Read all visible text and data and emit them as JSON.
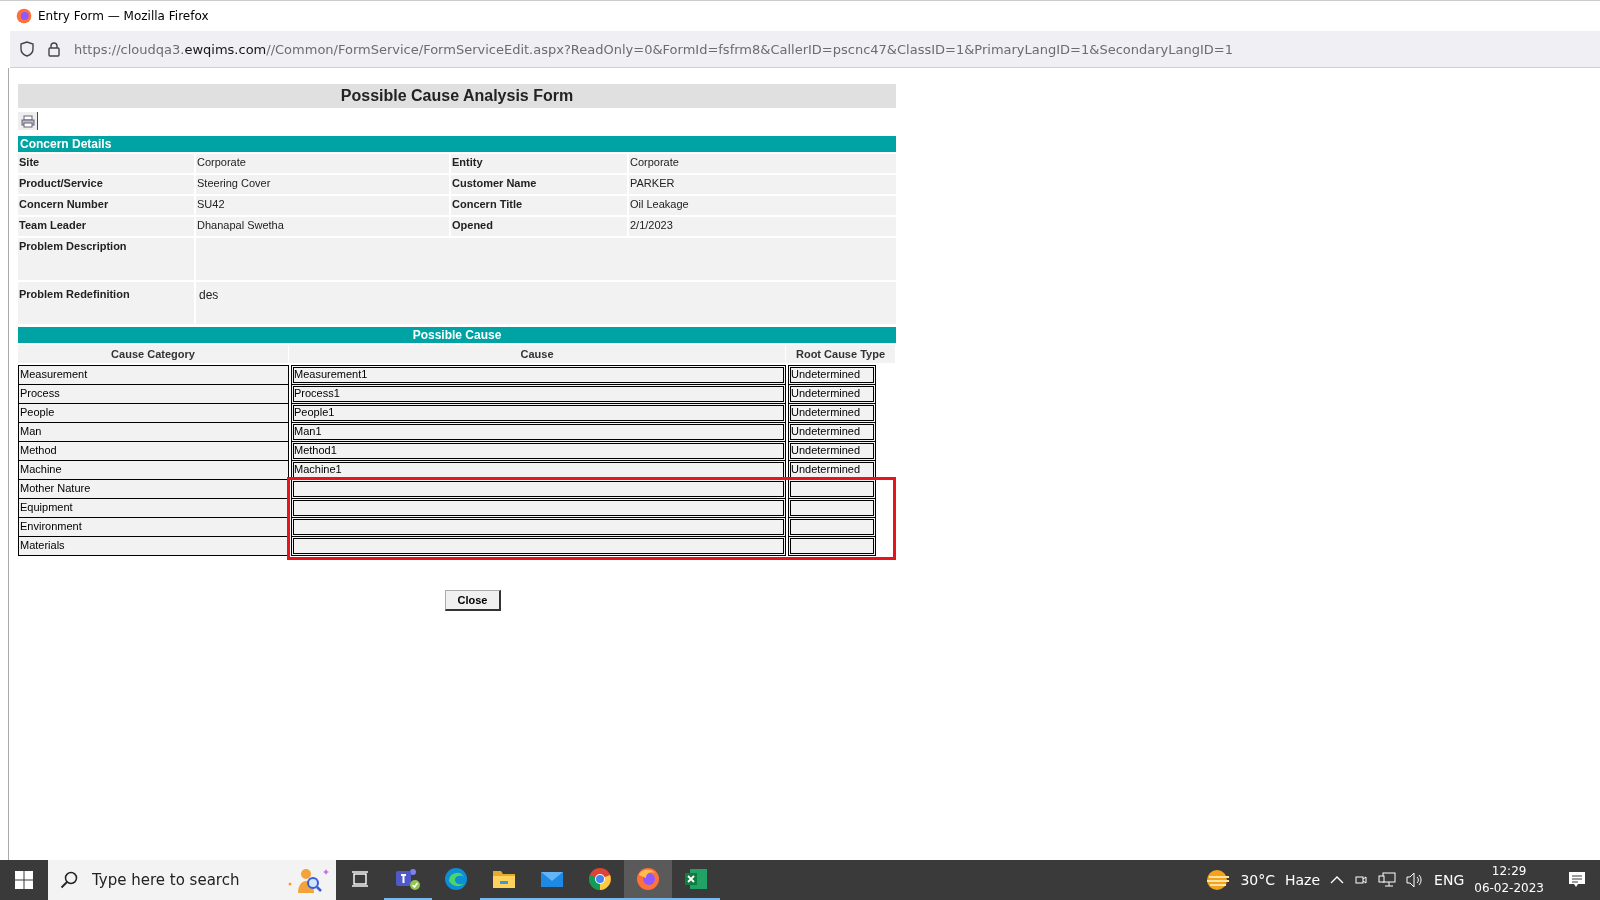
{
  "window": {
    "title": "Entry Form — Mozilla Firefox"
  },
  "address_bar": {
    "url_start": "https://cloudqa3.",
    "url_domain": "ewqims.com",
    "url_rest": "//Common/FormService/FormServiceEdit.aspx?ReadOnly=0&FormId=fsfrm8&CallerID=pscnc47&ClassID=1&PrimaryLangID=1&SecondaryLangID=1"
  },
  "form": {
    "title": "Possible Cause Analysis Form",
    "concern_details": {
      "heading": "Concern Details",
      "fields": [
        {
          "label": "Site",
          "value": "Corporate"
        },
        {
          "label": "Entity",
          "value": "Corporate"
        },
        {
          "label": "Product/Service",
          "value": "Steering Cover"
        },
        {
          "label": "Customer Name",
          "value": "PARKER"
        },
        {
          "label": "Concern Number",
          "value": "SU42"
        },
        {
          "label": "Concern Title",
          "value": "Oil Leakage"
        },
        {
          "label": "Team Leader",
          "value": "Dhanapal Swetha"
        },
        {
          "label": "Opened",
          "value": "2/1/2023"
        }
      ],
      "problem_description": {
        "label": "Problem Description"
      },
      "problem_redefinition": {
        "label": "Problem Redefinition",
        "value": "des"
      }
    },
    "possible_cause": {
      "heading": "Possible Cause",
      "columns": [
        "Cause Category",
        "Cause",
        "Root Cause Type"
      ],
      "rows": [
        {
          "category": "Measurement",
          "cause": "Measurement1",
          "root_cause_type": "Undetermined",
          "highlighted": false
        },
        {
          "category": "Process",
          "cause": "Process1",
          "root_cause_type": "Undetermined",
          "highlighted": false
        },
        {
          "category": "People",
          "cause": "People1",
          "root_cause_type": "Undetermined",
          "highlighted": false
        },
        {
          "category": "Man",
          "cause": "Man1",
          "root_cause_type": "Undetermined",
          "highlighted": false
        },
        {
          "category": "Method",
          "cause": "Method1",
          "root_cause_type": "Undetermined",
          "highlighted": false
        },
        {
          "category": "Machine",
          "cause": "Machine1",
          "root_cause_type": "Undetermined",
          "highlighted": false
        },
        {
          "category": "Mother Nature",
          "highlighted": true
        },
        {
          "category": "Equipment",
          "highlighted": true
        },
        {
          "category": "Environment",
          "highlighted": true
        },
        {
          "category": "Materials",
          "highlighted": true
        }
      ]
    },
    "close_button": "Close"
  },
  "taskbar": {
    "search_placeholder": "Type here to search",
    "apps": [
      {
        "kind": "task-view",
        "running": false,
        "selected": false
      },
      {
        "kind": "teams",
        "running": true,
        "selected": false
      },
      {
        "kind": "edge",
        "running": false,
        "selected": false
      },
      {
        "kind": "files",
        "running": true,
        "selected": false
      },
      {
        "kind": "mail",
        "running": true,
        "selected": false
      },
      {
        "kind": "chrome",
        "running": true,
        "selected": false
      },
      {
        "kind": "firefox",
        "running": true,
        "selected": true
      },
      {
        "kind": "excel",
        "running": true,
        "selected": false
      }
    ],
    "weather": {
      "temperature": "30°C",
      "condition": "Haze"
    },
    "language": "ENG",
    "time": "12:29",
    "date": "06-02-2023"
  }
}
